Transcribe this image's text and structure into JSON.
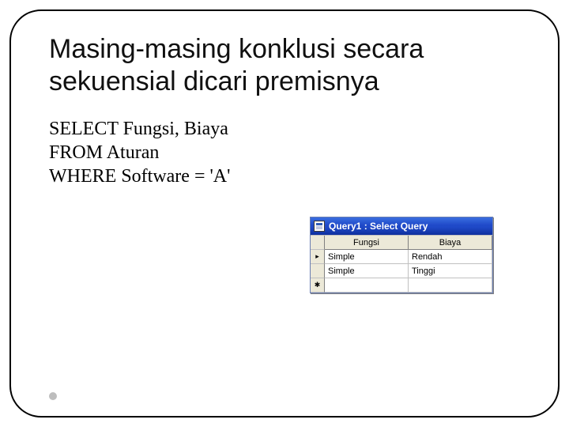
{
  "title": "Masing-masing konklusi secara sekuensial dicari premisnya",
  "sql": {
    "line1": "SELECT Fungsi, Biaya",
    "line2": "FROM Aturan",
    "line3": "WHERE Software = 'A'"
  },
  "queryWindow": {
    "title": "Query1 : Select Query",
    "columns": [
      "Fungsi",
      "Biaya"
    ],
    "rows": [
      {
        "c0": "Simple",
        "c1": "Rendah"
      },
      {
        "c0": "Simple",
        "c1": "Tinggi"
      }
    ]
  }
}
